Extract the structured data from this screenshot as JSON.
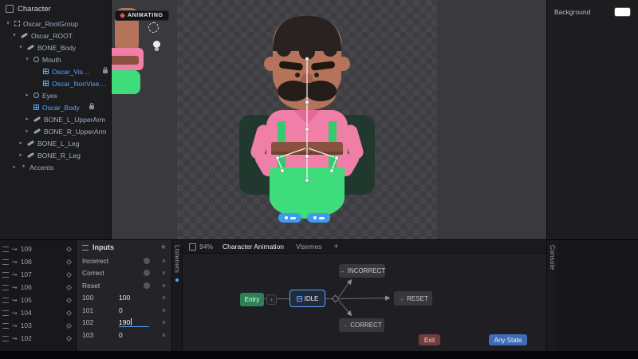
{
  "colors": {
    "accent": "#57a5ff",
    "entry_green": "#2e8057",
    "exit_red": "#703c3c",
    "any_state_blue": "#3d6cb4",
    "background_swatch": "#ffffff"
  },
  "icons": {
    "caret_down": "▾",
    "caret_right": "▸",
    "chevron": "›",
    "arrow_right": "→",
    "branch_arrow": "↪",
    "plus": "+",
    "close": "×",
    "star": "*"
  },
  "hierarchy": {
    "title": "Character",
    "items": [
      {
        "label": "Oscar_RootGroup"
      },
      {
        "label": "Oscar_ROOT"
      },
      {
        "label": "BONE_Body"
      },
      {
        "label": "Mouth"
      },
      {
        "label": "Oscar_Visemes"
      },
      {
        "label": "Oscar_NonVisemes_Mouth"
      },
      {
        "label": "Eyes"
      },
      {
        "label": "Oscar_Body"
      },
      {
        "label": "BONE_L_UpperArm"
      },
      {
        "label": "BONE_R_UpperArm"
      },
      {
        "label": "BONE_L_Leg"
      },
      {
        "label": "BONE_R_Leg"
      },
      {
        "label": "Accents"
      }
    ]
  },
  "canvas": {
    "badge": "ANIMATING"
  },
  "background_panel": {
    "title": "Background"
  },
  "timeline": {
    "rows": [
      "109",
      "108",
      "107",
      "106",
      "105",
      "104",
      "103",
      "102"
    ]
  },
  "inputs": {
    "title": "Inputs",
    "rows": [
      {
        "name": "Incorrect",
        "kind": "toggle"
      },
      {
        "name": "Correct",
        "kind": "toggle"
      },
      {
        "name": "Reset",
        "kind": "toggle"
      },
      {
        "name": "100",
        "value": "100"
      },
      {
        "name": "101",
        "value": "0"
      },
      {
        "name": "102",
        "value": "190",
        "editing": true
      },
      {
        "name": "103",
        "value": "0"
      }
    ]
  },
  "state_machine": {
    "zoom": "94%",
    "tabs": [
      "Character Animation",
      "Visemes"
    ],
    "left_tab": "Listeners",
    "right_tab": "Console",
    "nodes": {
      "entry": "Entry",
      "idle": "IDLE",
      "incorrect": "INCORRECT",
      "reset": "RESET",
      "correct": "CORRECT",
      "exit": "Exit",
      "any_state": "Any State"
    }
  }
}
